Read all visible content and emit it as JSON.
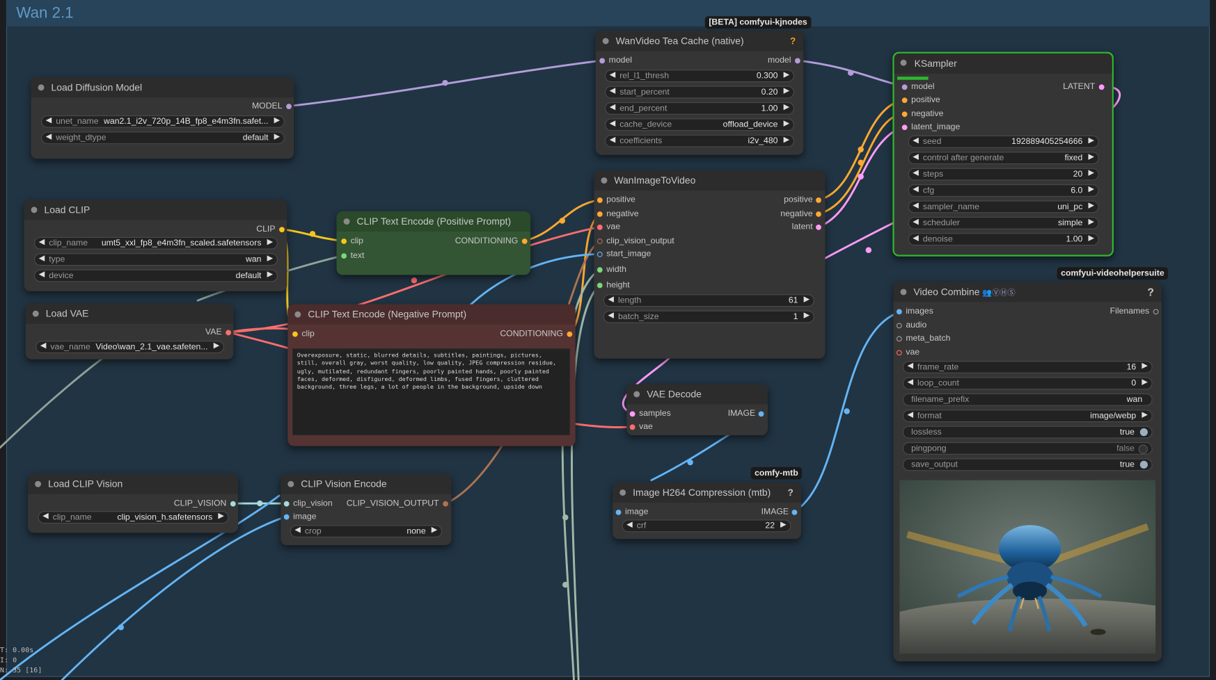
{
  "group": {
    "title": "Wan 2.1"
  },
  "badges": {
    "kjnodes": "[BETA] comfyui-kjnodes",
    "vhs": "comfyui-videohelpersuite",
    "mtb": "comfy-mtb"
  },
  "stats": {
    "line1": "T: 0.00s",
    "line2": "I: 0",
    "line3": "N: 35 [16]"
  },
  "nodes": {
    "load_diffusion_model": {
      "title": "Load Diffusion Model",
      "output": "MODEL",
      "widgets": [
        {
          "label": "unet_name",
          "value": "wan2.1_i2v_720p_14B_fp8_e4m3fn.safet..."
        },
        {
          "label": "weight_dtype",
          "value": "default"
        }
      ]
    },
    "load_clip": {
      "title": "Load CLIP",
      "output": "CLIP",
      "widgets": [
        {
          "label": "clip_name",
          "value": "umt5_xxl_fp8_e4m3fn_scaled.safetensors"
        },
        {
          "label": "type",
          "value": "wan"
        },
        {
          "label": "device",
          "value": "default"
        }
      ]
    },
    "load_vae": {
      "title": "Load VAE",
      "output": "VAE",
      "widgets": [
        {
          "label": "vae_name",
          "value": "Video\\wan_2.1_vae.safeten..."
        }
      ]
    },
    "load_clip_vision": {
      "title": "Load CLIP Vision",
      "output": "CLIP_VISION",
      "widgets": [
        {
          "label": "clip_name",
          "value": "clip_vision_h.safetensors"
        }
      ]
    },
    "clip_text_pos": {
      "title": "CLIP Text Encode (Positive Prompt)",
      "inputs": [
        "clip",
        "text"
      ],
      "output": "CONDITIONING"
    },
    "clip_text_neg": {
      "title": "CLIP Text Encode (Negative Prompt)",
      "inputs": [
        "clip"
      ],
      "output": "CONDITIONING",
      "text": "Overexposure, static, blurred details, subtitles, paintings, pictures, still, overall gray, worst quality, low quality, JPEG compression residue, ugly, mutilated, redundant fingers, poorly painted hands, poorly painted faces, deformed, disfigured, deformed limbs, fused fingers, cluttered background, three legs, a lot of people in the background, upside down"
    },
    "clip_vision_encode": {
      "title": "CLIP Vision Encode",
      "inputs": [
        "clip_vision",
        "image"
      ],
      "output": "CLIP_VISION_OUTPUT",
      "widgets": [
        {
          "label": "crop",
          "value": "none"
        }
      ]
    },
    "tea_cache": {
      "title": "WanVideo Tea Cache (native)",
      "input": "model",
      "output": "model",
      "help": "?",
      "widgets": [
        {
          "label": "rel_l1_thresh",
          "value": "0.300"
        },
        {
          "label": "start_percent",
          "value": "0.20"
        },
        {
          "label": "end_percent",
          "value": "1.00"
        },
        {
          "label": "cache_device",
          "value": "offload_device"
        },
        {
          "label": "coefficients",
          "value": "i2v_480"
        }
      ]
    },
    "wan_image_to_video": {
      "title": "WanImageToVideo",
      "inputs": [
        "positive",
        "negative",
        "vae",
        "clip_vision_output",
        "start_image",
        "width",
        "height"
      ],
      "outputs": [
        "positive",
        "negative",
        "latent"
      ],
      "widgets": [
        {
          "label": "length",
          "value": "61"
        },
        {
          "label": "batch_size",
          "value": "1"
        }
      ]
    },
    "ksampler": {
      "title": "KSampler",
      "inputs": [
        "model",
        "positive",
        "negative",
        "latent_image"
      ],
      "output": "LATENT",
      "widgets": [
        {
          "label": "seed",
          "value": "192889405254666"
        },
        {
          "label": "control after generate",
          "value": "fixed"
        },
        {
          "label": "steps",
          "value": "20"
        },
        {
          "label": "cfg",
          "value": "6.0"
        },
        {
          "label": "sampler_name",
          "value": "uni_pc"
        },
        {
          "label": "scheduler",
          "value": "simple"
        },
        {
          "label": "denoise",
          "value": "1.00"
        }
      ]
    },
    "vae_decode": {
      "title": "VAE Decode",
      "inputs": [
        "samples",
        "vae"
      ],
      "output": "IMAGE"
    },
    "image_h264": {
      "title": "Image H264 Compression (mtb)",
      "input": "image",
      "output": "IMAGE",
      "help": "?",
      "widgets": [
        {
          "label": "crf",
          "value": "22"
        }
      ]
    },
    "video_combine": {
      "title": "Video Combine",
      "title_icons": "👥ⓋⒽⓈ",
      "inputs": [
        "images",
        "audio",
        "meta_batch",
        "vae"
      ],
      "output": "Filenames",
      "help": "?",
      "widgets": [
        {
          "label": "frame_rate",
          "value": "16"
        },
        {
          "label": "loop_count",
          "value": "0"
        },
        {
          "label": "filename_prefix",
          "value": "wan"
        },
        {
          "label": "format",
          "value": "image/webp"
        }
      ],
      "toggles": [
        {
          "label": "lossless",
          "value": "true"
        },
        {
          "label": "pingpong",
          "value": "false"
        },
        {
          "label": "save_output",
          "value": "true"
        }
      ]
    }
  },
  "colors": {
    "model": "#b39ddb",
    "clip": "#f5c61d",
    "conditioning": "#ffa931",
    "vae": "#ff6e6e",
    "clip_vision": "#a8dadc",
    "clip_vision_output": "#ad7452",
    "image": "#64b5f6",
    "latent": "#ff9cf9",
    "int": "#7cd67c",
    "neutral": "#a0a0a0",
    "pos_node": "#335533",
    "neg_node": "#553333",
    "ksampler_border": "#2eb82e"
  }
}
